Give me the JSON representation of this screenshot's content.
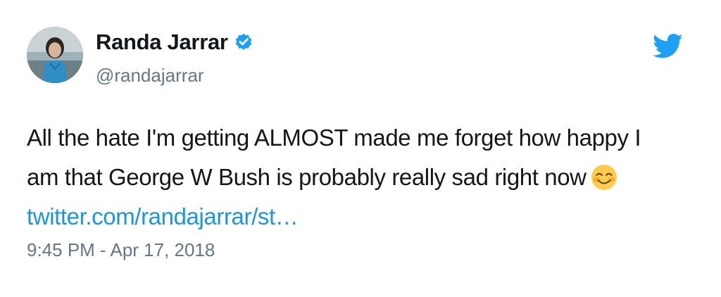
{
  "author": {
    "display_name": "Randa Jarrar",
    "handle": "@randajarrar",
    "verified": true
  },
  "icons": {
    "avatar": "avatar",
    "verified": "verified-badge-icon",
    "logo": "twitter-bird-icon",
    "emoji": "smiling-face-with-smiling-eyes-emoji-icon"
  },
  "tweet": {
    "line1": "All the hate I'm getting ALMOST made me forget how happy I",
    "line2": "am that George W Bush is probably really sad right now",
    "link": "twitter.com/randajarrar/st…",
    "timestamp": "9:45 PM - Apr 17, 2018"
  },
  "colors": {
    "twitter_blue": "#1da1f2",
    "link_blue": "#1b95e0",
    "secondary_text": "#657786",
    "primary_text": "#14171a"
  }
}
